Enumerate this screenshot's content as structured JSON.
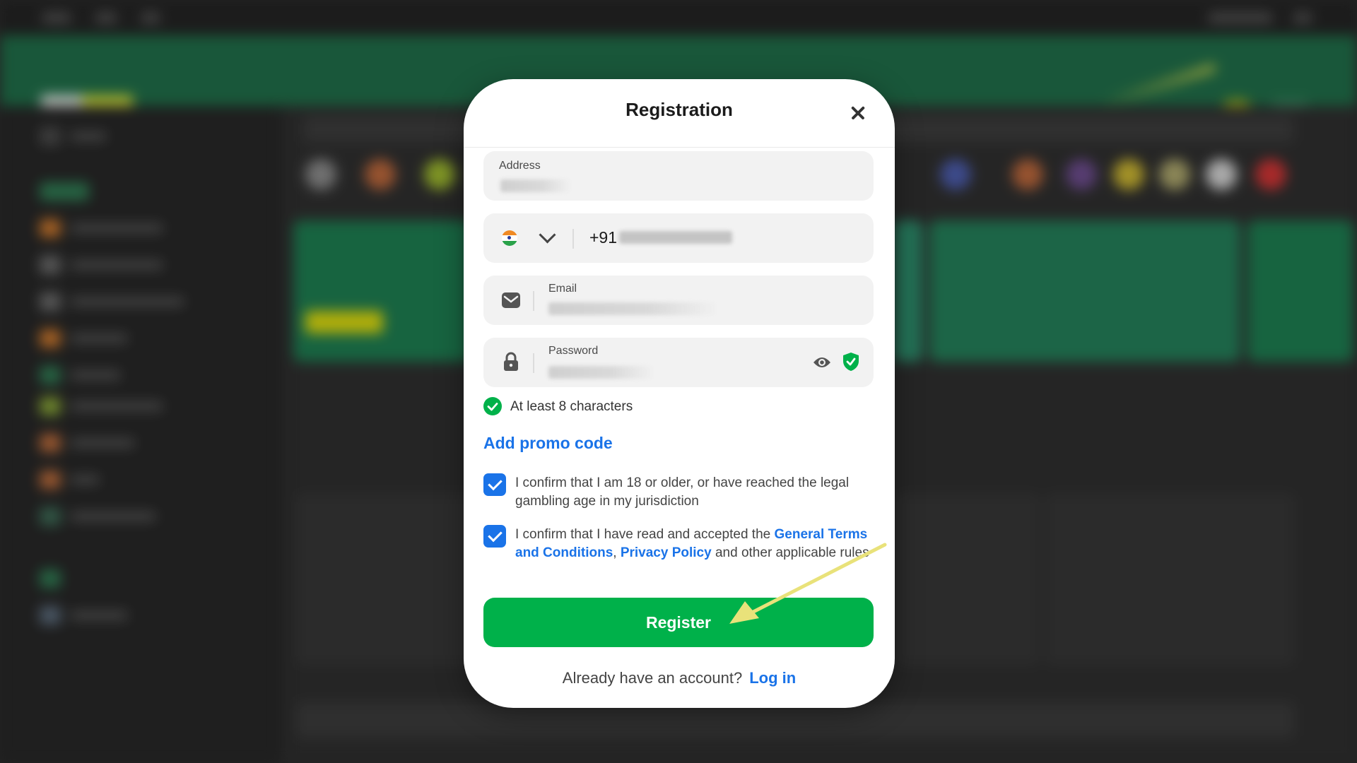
{
  "modal": {
    "title": "Registration",
    "close_icon": "close-icon"
  },
  "form": {
    "address": {
      "label": "Address"
    },
    "phone": {
      "country_flag": "india-flag-icon",
      "dial_code": "+91"
    },
    "email": {
      "label": "Email",
      "icon": "envelope-icon"
    },
    "password": {
      "label": "Password",
      "icon": "lock-icon",
      "toggle_icon": "eye-icon",
      "strength_icon": "shield-check-icon"
    },
    "password_hint": "At least 8 characters",
    "promo_link": "Add promo code",
    "age_confirm": "I confirm that I am 18 or older, or have reached the legal gambling age in my jurisdiction",
    "terms_confirm": {
      "prefix": "I confirm that I have read and accepted the ",
      "terms_link": "General Terms and Conditions",
      "comma": ", ",
      "privacy_link": "Privacy Policy",
      "suffix": " and other applicable rules"
    },
    "register_button": "Register",
    "already_text": "Already have an account?",
    "login_link": "Log in"
  },
  "colors": {
    "accent_green": "#00b14a",
    "link_blue": "#1a73e8",
    "background_bar": "#1f6b47",
    "annotation_arrow": "#e9e27a"
  }
}
